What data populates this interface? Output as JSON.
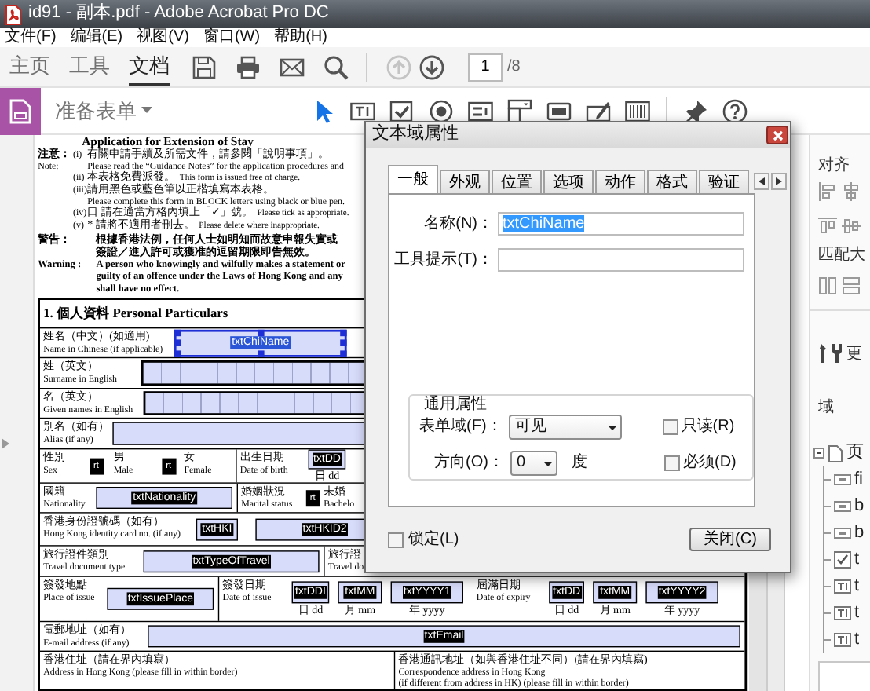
{
  "window": {
    "title": "id91 - 副本.pdf - Adobe Acrobat Pro DC"
  },
  "menu": [
    "文件(F)",
    "编辑(E)",
    "视图(V)",
    "窗口(W)",
    "帮助(H)"
  ],
  "toolbar": {
    "tabs": [
      {
        "label": "主页",
        "selected": false
      },
      {
        "label": "工具",
        "selected": false
      },
      {
        "label": "文档",
        "selected": true
      }
    ],
    "previous_disabled": true,
    "next_disabled": false,
    "page": "1",
    "page_count": "/8"
  },
  "forms_bar": {
    "title": "准备表单",
    "tools": [
      {
        "kind": "select",
        "selected": true
      },
      {
        "kind": "text-field",
        "selected": false
      },
      {
        "kind": "checkbox",
        "selected": false
      },
      {
        "kind": "radio",
        "selected": false
      },
      {
        "kind": "list-box",
        "selected": false
      },
      {
        "kind": "dropdown",
        "selected": false
      },
      {
        "kind": "button",
        "selected": false
      },
      {
        "kind": "signature",
        "selected": false
      },
      {
        "kind": "barcode",
        "selected": false
      },
      {
        "kind": "pin",
        "selected": false
      },
      {
        "kind": "help",
        "selected": false
      }
    ]
  },
  "document": {
    "heading": "Application for Extension of Stay",
    "notes": {
      "label_zh": "注意：",
      "label_en": "Note:",
      "items": [
        {
          "number": "(i)",
          "kind": "two-line",
          "zh": "有關申請手續及所需文件，請參閱「說明事項」。",
          "en": "Please read the “Guidance Notes” for the application procedures and"
        },
        {
          "number": "(ii)",
          "kind": "one-line",
          "zh": "本表格免費派發。",
          "en": "This form is issued free of charge."
        },
        {
          "number": "(iii)",
          "kind": "two-line",
          "zh": "請用黑色或藍色筆以正楷填寫本表格。",
          "en": "Please complete this form in BLOCK letters using black or blue pen."
        },
        {
          "number": "(iv)",
          "kind": "one-line",
          "zh": "口 請在適當方格內填上「✓」號。",
          "en": "Please tick as appropriate."
        },
        {
          "number": "(v)",
          "kind": "one-line",
          "zh": "* 請將不適用者刪去。",
          "en": "Please delete where inappropriate."
        }
      ]
    },
    "warning": {
      "label_zh": "警告：",
      "lines_zh": [
        "根據香港法例，任何人士如明知而故意申報失實或",
        "簽證／進入許可或獲准的逗留期限即告無效。"
      ],
      "label_en": "Warning :",
      "lines_en": [
        "A person who knowingly and wilfully makes a statement or",
        "guilty of an offence under the Laws of Hong Kong and any",
        "shall have no effect."
      ]
    },
    "section": "1. 個人資料 Personal Particulars",
    "lines": [
      {
        "parts": [
          {
            "kind": "label",
            "lines": [
              "姓名（中文）(如適用)",
              "Name in Chinese (if applicable)"
            ]
          },
          {
            "kind": "field",
            "name": "txtChiName",
            "selected": true
          }
        ]
      },
      {
        "parts": [
          {
            "kind": "label",
            "lines": [
              "姓（英文）",
              "Surname in English"
            ]
          },
          {
            "kind": "comb"
          }
        ]
      },
      {
        "parts": [
          {
            "kind": "label",
            "lines": [
              "名（英文）",
              "Given names in English"
            ]
          },
          {
            "kind": "comb"
          }
        ]
      },
      {
        "parts": [
          {
            "kind": "label",
            "lines": [
              "別名（如有）",
              "Alias (if any)"
            ]
          },
          {
            "kind": "blank"
          }
        ]
      },
      {
        "parts": [
          {
            "kind": "label",
            "lines": [
              "性別",
              "Sex"
            ]
          },
          {
            "kind": "check",
            "name": "rt"
          },
          {
            "kind": "label",
            "lines": [
              "男",
              "Male"
            ]
          },
          {
            "kind": "check",
            "name": "rt"
          },
          {
            "kind": "label",
            "lines": [
              "女",
              "Female"
            ]
          },
          {
            "kind": "label",
            "lines": [
              "出生日期",
              "Date of birth"
            ]
          },
          {
            "kind": "field",
            "name": "txtDD",
            "selected": false,
            "caption": "日 dd"
          }
        ]
      },
      {
        "parts": [
          {
            "kind": "label",
            "lines": [
              "國籍",
              "Nationality"
            ]
          },
          {
            "kind": "field",
            "name": "txtNationality",
            "selected": false
          },
          {
            "kind": "label",
            "lines": [
              "婚姻狀況",
              "Marital status"
            ]
          },
          {
            "kind": "check",
            "name": "rt"
          },
          {
            "kind": "label",
            "lines": [
              "未婚",
              "Bachelo"
            ]
          }
        ]
      },
      {
        "parts": [
          {
            "kind": "label",
            "lines": [
              "香港身份證號碼（如有）",
              "Hong Kong identity card no. (if any)"
            ]
          },
          {
            "kind": "field",
            "name": "txtHKI",
            "selected": false
          },
          {
            "kind": "field",
            "name": "txtHKID2",
            "selected": false
          }
        ]
      },
      {
        "parts": [
          {
            "kind": "label",
            "lines": [
              "旅行證件類別",
              "Travel document type"
            ]
          },
          {
            "kind": "field",
            "name": "txtTypeOfTravel",
            "selected": false
          },
          {
            "kind": "label",
            "lines": [
              "旅行證",
              "Travel do"
            ]
          }
        ]
      },
      {
        "parts": [
          {
            "kind": "label",
            "lines": [
              "簽發地點",
              "Place of issue"
            ]
          },
          {
            "kind": "field",
            "name": "txtIssuePlace",
            "selected": false
          },
          {
            "kind": "label",
            "lines": [
              "簽發日期",
              "Date of issue"
            ]
          },
          {
            "kind": "field",
            "name": "txtDDI",
            "selected": false,
            "caption": "日 dd"
          },
          {
            "kind": "field",
            "name": "txtMM",
            "selected": false,
            "caption": "月 mm"
          },
          {
            "kind": "field",
            "name": "txtYYYY1",
            "selected": false,
            "caption": "年 yyyy"
          },
          {
            "kind": "label",
            "lines": [
              "屆滿日期",
              "Date of expiry"
            ]
          },
          {
            "kind": "field",
            "name": "txtDD",
            "selected": false,
            "caption": "日 dd"
          },
          {
            "kind": "field",
            "name": "txtMM",
            "selected": false,
            "caption": "月 mm"
          },
          {
            "kind": "field",
            "name": "txtYYYY2",
            "selected": false,
            "caption": "年 yyyy"
          }
        ]
      },
      {
        "parts": [
          {
            "kind": "label",
            "lines": [
              "電郵地址（如有）",
              "E-mail address (if any)"
            ]
          },
          {
            "kind": "field",
            "name": "txtEmail",
            "selected": false
          }
        ]
      },
      {
        "parts": [
          {
            "kind": "label",
            "lines": [
              "香港住址（請在界內填寫）",
              "Address in Hong Kong (please fill in within border)"
            ]
          },
          {
            "kind": "label",
            "lines": [
              "香港通訊地址（如與香港住址不同）(請在界內填寫)",
              "Correspondence address in Hong Kong",
              "(if different from address in HK) (please fill in within border)"
            ]
          }
        ]
      }
    ]
  },
  "properties_dialog": {
    "title": "文本域属性",
    "tabs": [
      {
        "label": "一般",
        "selected": true
      },
      {
        "label": "外观",
        "selected": false
      },
      {
        "label": "位置",
        "selected": false
      },
      {
        "label": "选项",
        "selected": false
      },
      {
        "label": "动作",
        "selected": false
      },
      {
        "label": "格式",
        "selected": false
      },
      {
        "label": "验证",
        "selected": false
      }
    ],
    "name_label": "名称(N)：",
    "name_value": "txtChiName",
    "tooltip_label": "工具提示(T)：",
    "group_label": "通用属性",
    "form_field_label": "表单域(F)：",
    "form_field_value": "可见",
    "orientation_label": "方向(O)：",
    "orientation_value": "0",
    "orientation_unit": "度",
    "read_only": {
      "label": "只读(R)",
      "checked": false
    },
    "required": {
      "label": "必须(D)",
      "checked": false
    },
    "locked": {
      "label": "锁定(L)",
      "checked": false
    },
    "close_button": "关闭(C)"
  },
  "right_panel": {
    "align_title": "对齐",
    "size_title": "匹配大",
    "more_label": "更",
    "fields_title": "域",
    "tree": [
      {
        "label": "页",
        "kind": "page",
        "expanded": true,
        "children": [
          {
            "label": "fi",
            "kind": "button"
          },
          {
            "label": "b",
            "kind": "button"
          },
          {
            "label": "b",
            "kind": "button"
          },
          {
            "label": "t",
            "kind": "checkbox"
          },
          {
            "label": "t",
            "kind": "text"
          },
          {
            "label": "t",
            "kind": "text"
          },
          {
            "label": "t",
            "kind": "text"
          }
        ]
      }
    ]
  }
}
